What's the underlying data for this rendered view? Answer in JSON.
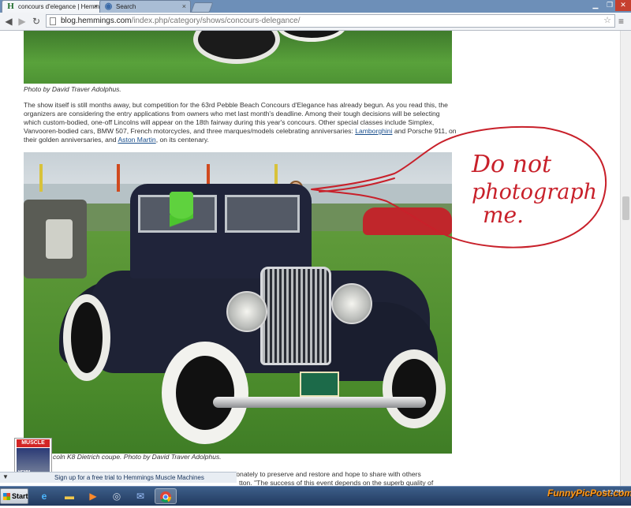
{
  "browser": {
    "tabs": [
      {
        "label": "concours d'elegance | Hemm",
        "favicon": "H",
        "active": true
      },
      {
        "label": "Search",
        "active": false
      }
    ],
    "url_host": "blog.hemmings.com",
    "url_path": "/index.php/category/shows/concours-delegance/"
  },
  "article": {
    "caption_top": "Photo by David Traver Adolphus.",
    "paragraph_part1": "The show itself is still months away, but competition for the 63rd Pebble Beach Concours d'Elegance has already begun. As you read this, the organizers are considering the entry applications from owners who met last month's deadline. Among their tough decisions will be selecting which custom-bodied, one-off Lincolns will appear on the 18th fairway during this year's concours. Other special classes include Simplex, Vanvooren-bodied cars, BMW 507, French motorcycles, and three marques/models celebrating anniversaries: ",
    "link_lamborghini": "Lamborghini",
    "paragraph_part2": " and Porsche 911, on their golden anniversaries, and ",
    "link_aston": "Aston Martin",
    "paragraph_part3": ", on its centenary.",
    "caption_car": "coln K8 Dietrich coupe. Photo by David Traver Adolphus.",
    "paragraph_bottom_left": "see the many automobiles that people have worked so passionately to preserve and restore and hope to share with others",
    "paragraph_bottom_right": "tton. \"The success of this event depends on the superb quality of"
  },
  "handwriting": "Do not photograph me.",
  "popup": {
    "ad_title": "MUSCLE",
    "ad_subtitle": "HEMM",
    "bar_text": "Sign up for a free trial to Hemmings Muscle Machines"
  },
  "taskbar": {
    "start_label": "Start",
    "clock_time": "9:12 PM"
  },
  "watermark": "FunnyPicPost.com",
  "colors": {
    "tab_strip": "#6d8fb8",
    "link": "#1a4f8c",
    "doodle": "#c8202a",
    "taskbar": "#2a4670"
  }
}
